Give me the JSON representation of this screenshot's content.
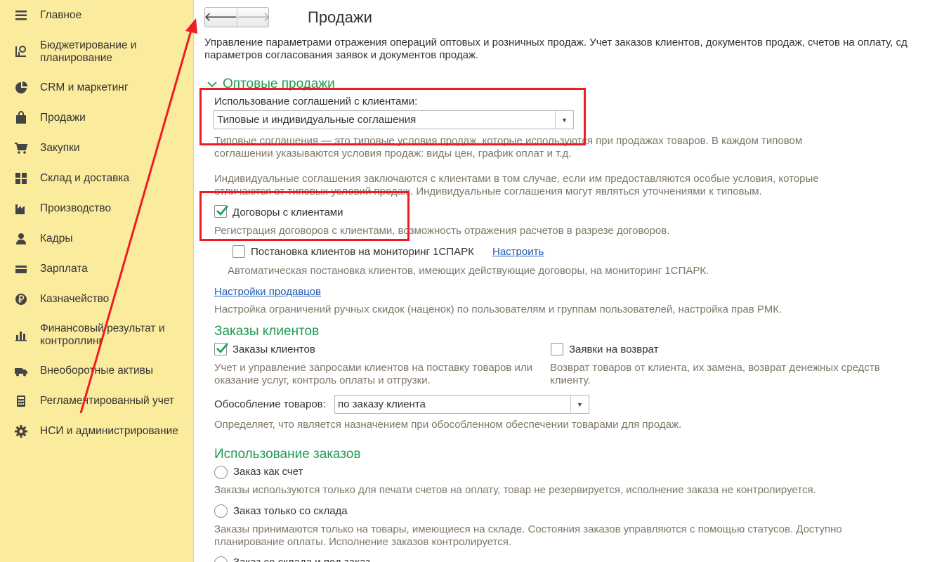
{
  "sidebar": {
    "items": [
      {
        "label": "Главное",
        "icon": "menu-lines-icon"
      },
      {
        "label": "Бюджетирование и\nпланирование",
        "icon": "budget-chart-icon"
      },
      {
        "label": "CRM и маркетинг",
        "icon": "pie-chart-icon"
      },
      {
        "label": "Продажи",
        "icon": "shopping-bag-icon"
      },
      {
        "label": "Закупки",
        "icon": "cart-icon"
      },
      {
        "label": "Склад и доставка",
        "icon": "warehouse-grid-icon"
      },
      {
        "label": "Производство",
        "icon": "factory-icon"
      },
      {
        "label": "Кадры",
        "icon": "person-icon"
      },
      {
        "label": "Зарплата",
        "icon": "wallet-card-icon"
      },
      {
        "label": "Казначейство",
        "icon": "ruble-coin-icon"
      },
      {
        "label": "Финансовый результат и\nконтроллинг",
        "icon": "bar-chart-icon"
      },
      {
        "label": "Внеоборотные активы",
        "icon": "truck-icon"
      },
      {
        "label": "Регламентированный учет",
        "icon": "calculator-icon"
      },
      {
        "label": "НСИ и администрирование",
        "icon": "gear-icon"
      }
    ]
  },
  "header": {
    "back_glyph": "🡐",
    "forward_glyph": "🡒",
    "title": "Продажи"
  },
  "intro": {
    "line1": "Управление параметрами отражения операций оптовых и розничных продаж. Учет заказов клиентов, документов продаж, счетов на оплату, сд",
    "line2": "параметров согласования заявок и документов продаж."
  },
  "wholesale": {
    "title": "Оптовые продажи",
    "agreements_label": "Использование соглашений с клиентами:",
    "agreements_value": "Типовые и индивидуальные соглашения",
    "typical_desc1": "Типовые соглашения — это типовые условия продаж, которые используются при продажах товаров. В каждом типовом",
    "typical_desc2": "соглашении указываются условия продаж: виды цен, график оплат и т.д.",
    "individual_desc1": "Индивидуальные соглашения заключаются с клиентами в том случае, если им предоставляются особые условия, которые",
    "individual_desc2": "отличаются от типовых условий продаж. Индивидуальные соглашения могут являться уточнениями к типовым.",
    "contracts_label": "Договоры с клиентами",
    "contracts_checked": true,
    "contracts_desc": "Регистрация договоров с клиентами, возможность отражения расчетов в разрезе договоров.",
    "spark_label": "Постановка клиентов на мониторинг 1СПАРК",
    "spark_checked": false,
    "spark_link": "Настроить",
    "spark_desc": "Автоматическая постановка клиентов, имеющих действующие договоры, на мониторинг 1СПАРК.",
    "sellers_link": "Настройки продавцов",
    "sellers_desc": "Настройка ограничений ручных скидок (наценок) по пользователям и группам пользователей, настройка прав РМК."
  },
  "orders": {
    "title": "Заказы клиентов",
    "client_orders_label": "Заказы клиентов",
    "client_orders_checked": true,
    "client_orders_desc1": "Учет и управление запросами клиентов на поставку товаров или",
    "client_orders_desc2": "оказание услуг, контроль оплаты и отгрузки.",
    "returns_label": "Заявки на возврат",
    "returns_checked": false,
    "returns_desc1": "Возврат товаров от клиента, их замена, возврат денежных средств",
    "returns_desc2": "клиенту.",
    "separation_label": "Обособление товаров:",
    "separation_value": "по заказу клиента",
    "separation_desc": "Определяет, что является назначением при обособленном обеспечении товарами для продаж."
  },
  "usage": {
    "title": "Использование заказов",
    "opt1_label": "Заказ как счет",
    "opt1_desc": "Заказы используются только для печати счетов на оплату, товар не резервируется, исполнение заказа не контролируется.",
    "opt2_label": "Заказ только со склада",
    "opt2_desc1": "Заказы принимаются только на товары, имеющиеся на складе. Состояния заказов управляются с помощью статусов. Доступно",
    "opt2_desc2": "планирование оплаты. Исполнение заказов контролируется.",
    "opt3_label": "Заказ со склада и под заказ"
  },
  "colors": {
    "sidebar_bg": "#fbeb9d",
    "accent_green": "#1f9b51",
    "highlight_red": "#ee1c24",
    "link_blue": "#1f5ab5"
  }
}
